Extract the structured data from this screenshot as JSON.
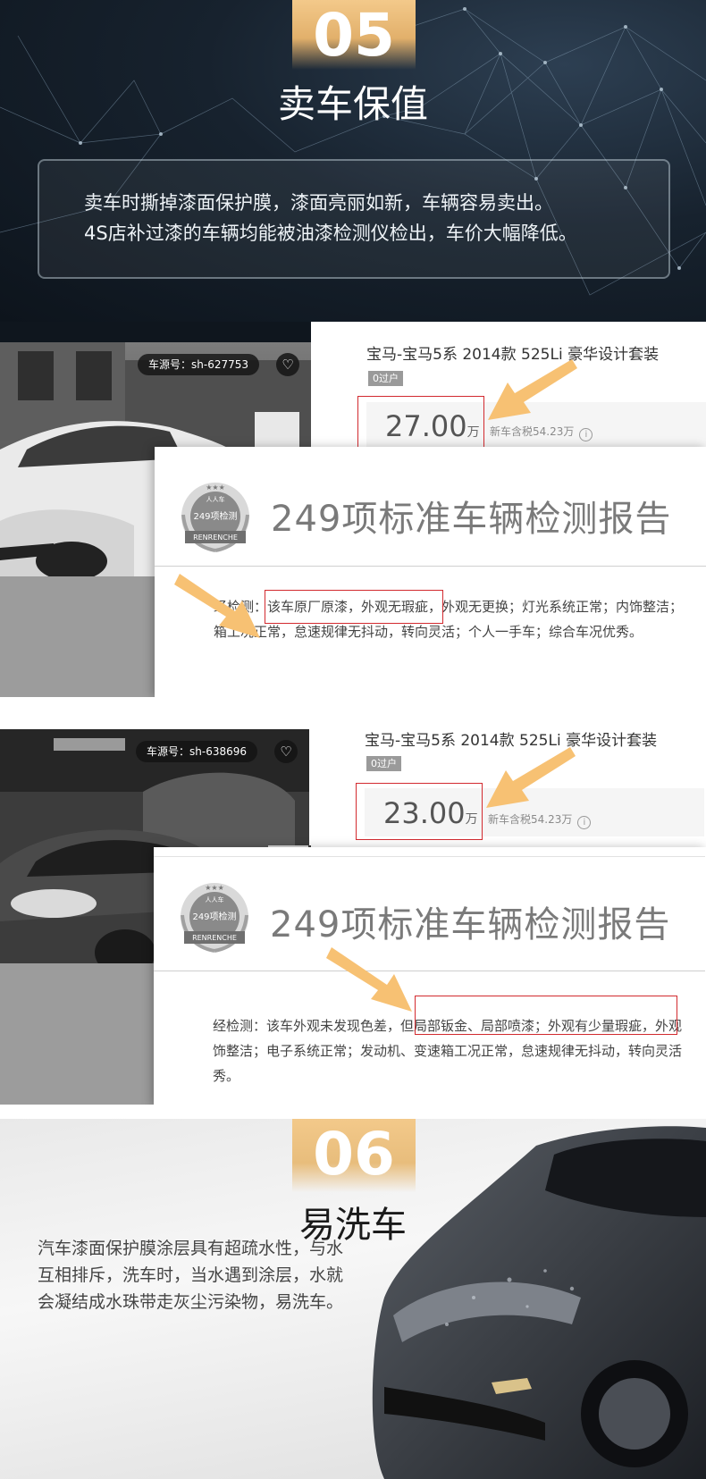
{
  "section05": {
    "number": "05",
    "title": "卖车保值",
    "lines": [
      "卖车时撕掉漆面保护膜，漆面亮丽如新，车辆容易卖出。",
      "4S店补过漆的车辆均能被油漆检测仪检出，车价大幅降低。"
    ]
  },
  "cars": [
    {
      "source_label": "车源号：sh-627753",
      "title": "宝马-宝马5系 2014款 525Li 豪华设计套装",
      "tag": "0过户",
      "price": "27.00",
      "price_unit": "万",
      "new_price": "新车含税54.23万",
      "info_icon": "i",
      "report_title": "249项标准车辆检测报告",
      "seal_text": "249项检测",
      "seal_brand": "RENRENCHE",
      "seal_top": "人人车",
      "report_lines": [
        "经检测：该车原厂原漆，外观无瑕疵，外观无更换；灯光系统正常；内饰整洁；",
        "箱工况正常，怠速规律无抖动，转向灵活；个人一手车；综合车况优秀。"
      ]
    },
    {
      "source_label": "车源号：sh-638696",
      "title": "宝马-宝马5系 2014款 525Li 豪华设计套装",
      "tag": "0过户",
      "price": "23.00",
      "price_unit": "万",
      "new_price": "新车含税54.23万",
      "info_icon": "i",
      "report_title": "249项标准车辆检测报告",
      "seal_text": "249项检测",
      "seal_brand": "RENRENCHE",
      "seal_top": "人人车",
      "report_lines": [
        "经检测：该车外观未发现色差，但局部钣金、局部喷漆；外观有少量瑕疵，外观",
        "饰整洁；电子系统正常；发动机、变速箱工况正常，怠速规律无抖动，转向灵活",
        "秀。"
      ]
    }
  ],
  "section06": {
    "number": "06",
    "title": "易洗车",
    "lines": [
      "汽车漆面保护膜涂层具有超疏水性，与水",
      "互相排斥，洗车时，当水遇到涂层，水就",
      "会凝结成水珠带走灰尘污染物，易洗车。"
    ]
  },
  "colors": {
    "accent_gold": "#e2b06b",
    "highlight_red": "#d22a2f",
    "arrow_orange": "#f7c173"
  }
}
